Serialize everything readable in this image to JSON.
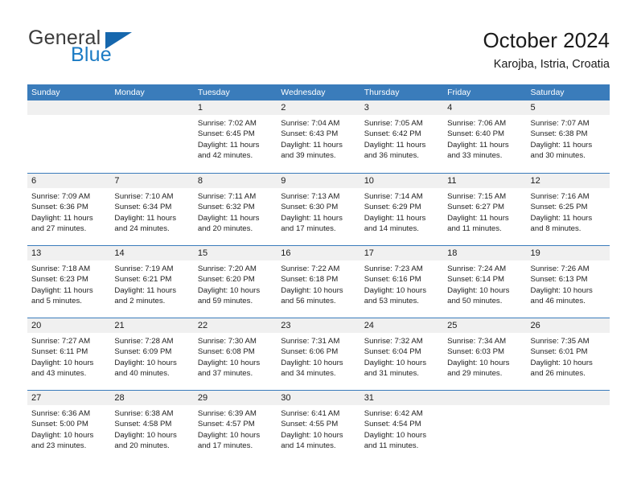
{
  "brand": {
    "name_part1": "General",
    "name_part2": "Blue",
    "logo_icon": "triangle-icon",
    "accent_color": "#1b7bc4"
  },
  "header": {
    "title": "October 2024",
    "location": "Karojba, Istria, Croatia"
  },
  "calendar": {
    "header_bg_color": "#3a7cbb",
    "row_divider_color": "#3a7cbb",
    "day_band_color": "#f0f0f0",
    "weekdays": [
      "Sunday",
      "Monday",
      "Tuesday",
      "Wednesday",
      "Thursday",
      "Friday",
      "Saturday"
    ],
    "weeks": [
      [
        {
          "day": "",
          "sunrise": "",
          "sunset": "",
          "daylight_line1": "",
          "daylight_line2": ""
        },
        {
          "day": "",
          "sunrise": "",
          "sunset": "",
          "daylight_line1": "",
          "daylight_line2": ""
        },
        {
          "day": "1",
          "sunrise": "Sunrise: 7:02 AM",
          "sunset": "Sunset: 6:45 PM",
          "daylight_line1": "Daylight: 11 hours",
          "daylight_line2": "and 42 minutes."
        },
        {
          "day": "2",
          "sunrise": "Sunrise: 7:04 AM",
          "sunset": "Sunset: 6:43 PM",
          "daylight_line1": "Daylight: 11 hours",
          "daylight_line2": "and 39 minutes."
        },
        {
          "day": "3",
          "sunrise": "Sunrise: 7:05 AM",
          "sunset": "Sunset: 6:42 PM",
          "daylight_line1": "Daylight: 11 hours",
          "daylight_line2": "and 36 minutes."
        },
        {
          "day": "4",
          "sunrise": "Sunrise: 7:06 AM",
          "sunset": "Sunset: 6:40 PM",
          "daylight_line1": "Daylight: 11 hours",
          "daylight_line2": "and 33 minutes."
        },
        {
          "day": "5",
          "sunrise": "Sunrise: 7:07 AM",
          "sunset": "Sunset: 6:38 PM",
          "daylight_line1": "Daylight: 11 hours",
          "daylight_line2": "and 30 minutes."
        }
      ],
      [
        {
          "day": "6",
          "sunrise": "Sunrise: 7:09 AM",
          "sunset": "Sunset: 6:36 PM",
          "daylight_line1": "Daylight: 11 hours",
          "daylight_line2": "and 27 minutes."
        },
        {
          "day": "7",
          "sunrise": "Sunrise: 7:10 AM",
          "sunset": "Sunset: 6:34 PM",
          "daylight_line1": "Daylight: 11 hours",
          "daylight_line2": "and 24 minutes."
        },
        {
          "day": "8",
          "sunrise": "Sunrise: 7:11 AM",
          "sunset": "Sunset: 6:32 PM",
          "daylight_line1": "Daylight: 11 hours",
          "daylight_line2": "and 20 minutes."
        },
        {
          "day": "9",
          "sunrise": "Sunrise: 7:13 AM",
          "sunset": "Sunset: 6:30 PM",
          "daylight_line1": "Daylight: 11 hours",
          "daylight_line2": "and 17 minutes."
        },
        {
          "day": "10",
          "sunrise": "Sunrise: 7:14 AM",
          "sunset": "Sunset: 6:29 PM",
          "daylight_line1": "Daylight: 11 hours",
          "daylight_line2": "and 14 minutes."
        },
        {
          "day": "11",
          "sunrise": "Sunrise: 7:15 AM",
          "sunset": "Sunset: 6:27 PM",
          "daylight_line1": "Daylight: 11 hours",
          "daylight_line2": "and 11 minutes."
        },
        {
          "day": "12",
          "sunrise": "Sunrise: 7:16 AM",
          "sunset": "Sunset: 6:25 PM",
          "daylight_line1": "Daylight: 11 hours",
          "daylight_line2": "and 8 minutes."
        }
      ],
      [
        {
          "day": "13",
          "sunrise": "Sunrise: 7:18 AM",
          "sunset": "Sunset: 6:23 PM",
          "daylight_line1": "Daylight: 11 hours",
          "daylight_line2": "and 5 minutes."
        },
        {
          "day": "14",
          "sunrise": "Sunrise: 7:19 AM",
          "sunset": "Sunset: 6:21 PM",
          "daylight_line1": "Daylight: 11 hours",
          "daylight_line2": "and 2 minutes."
        },
        {
          "day": "15",
          "sunrise": "Sunrise: 7:20 AM",
          "sunset": "Sunset: 6:20 PM",
          "daylight_line1": "Daylight: 10 hours",
          "daylight_line2": "and 59 minutes."
        },
        {
          "day": "16",
          "sunrise": "Sunrise: 7:22 AM",
          "sunset": "Sunset: 6:18 PM",
          "daylight_line1": "Daylight: 10 hours",
          "daylight_line2": "and 56 minutes."
        },
        {
          "day": "17",
          "sunrise": "Sunrise: 7:23 AM",
          "sunset": "Sunset: 6:16 PM",
          "daylight_line1": "Daylight: 10 hours",
          "daylight_line2": "and 53 minutes."
        },
        {
          "day": "18",
          "sunrise": "Sunrise: 7:24 AM",
          "sunset": "Sunset: 6:14 PM",
          "daylight_line1": "Daylight: 10 hours",
          "daylight_line2": "and 50 minutes."
        },
        {
          "day": "19",
          "sunrise": "Sunrise: 7:26 AM",
          "sunset": "Sunset: 6:13 PM",
          "daylight_line1": "Daylight: 10 hours",
          "daylight_line2": "and 46 minutes."
        }
      ],
      [
        {
          "day": "20",
          "sunrise": "Sunrise: 7:27 AM",
          "sunset": "Sunset: 6:11 PM",
          "daylight_line1": "Daylight: 10 hours",
          "daylight_line2": "and 43 minutes."
        },
        {
          "day": "21",
          "sunrise": "Sunrise: 7:28 AM",
          "sunset": "Sunset: 6:09 PM",
          "daylight_line1": "Daylight: 10 hours",
          "daylight_line2": "and 40 minutes."
        },
        {
          "day": "22",
          "sunrise": "Sunrise: 7:30 AM",
          "sunset": "Sunset: 6:08 PM",
          "daylight_line1": "Daylight: 10 hours",
          "daylight_line2": "and 37 minutes."
        },
        {
          "day": "23",
          "sunrise": "Sunrise: 7:31 AM",
          "sunset": "Sunset: 6:06 PM",
          "daylight_line1": "Daylight: 10 hours",
          "daylight_line2": "and 34 minutes."
        },
        {
          "day": "24",
          "sunrise": "Sunrise: 7:32 AM",
          "sunset": "Sunset: 6:04 PM",
          "daylight_line1": "Daylight: 10 hours",
          "daylight_line2": "and 31 minutes."
        },
        {
          "day": "25",
          "sunrise": "Sunrise: 7:34 AM",
          "sunset": "Sunset: 6:03 PM",
          "daylight_line1": "Daylight: 10 hours",
          "daylight_line2": "and 29 minutes."
        },
        {
          "day": "26",
          "sunrise": "Sunrise: 7:35 AM",
          "sunset": "Sunset: 6:01 PM",
          "daylight_line1": "Daylight: 10 hours",
          "daylight_line2": "and 26 minutes."
        }
      ],
      [
        {
          "day": "27",
          "sunrise": "Sunrise: 6:36 AM",
          "sunset": "Sunset: 5:00 PM",
          "daylight_line1": "Daylight: 10 hours",
          "daylight_line2": "and 23 minutes."
        },
        {
          "day": "28",
          "sunrise": "Sunrise: 6:38 AM",
          "sunset": "Sunset: 4:58 PM",
          "daylight_line1": "Daylight: 10 hours",
          "daylight_line2": "and 20 minutes."
        },
        {
          "day": "29",
          "sunrise": "Sunrise: 6:39 AM",
          "sunset": "Sunset: 4:57 PM",
          "daylight_line1": "Daylight: 10 hours",
          "daylight_line2": "and 17 minutes."
        },
        {
          "day": "30",
          "sunrise": "Sunrise: 6:41 AM",
          "sunset": "Sunset: 4:55 PM",
          "daylight_line1": "Daylight: 10 hours",
          "daylight_line2": "and 14 minutes."
        },
        {
          "day": "31",
          "sunrise": "Sunrise: 6:42 AM",
          "sunset": "Sunset: 4:54 PM",
          "daylight_line1": "Daylight: 10 hours",
          "daylight_line2": "and 11 minutes."
        },
        {
          "day": "",
          "sunrise": "",
          "sunset": "",
          "daylight_line1": "",
          "daylight_line2": ""
        },
        {
          "day": "",
          "sunrise": "",
          "sunset": "",
          "daylight_line1": "",
          "daylight_line2": ""
        }
      ]
    ]
  }
}
